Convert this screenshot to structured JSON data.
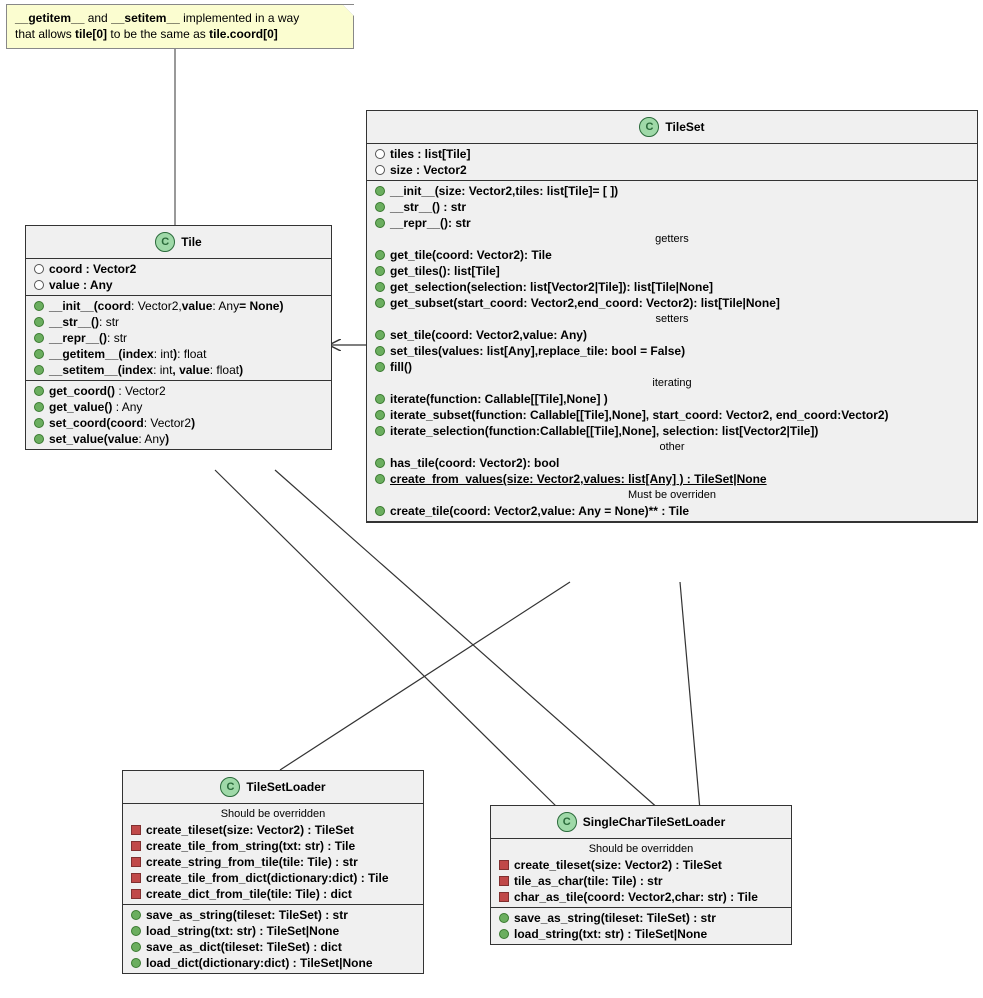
{
  "note": {
    "line1_a": "__getitem__",
    "line1_b": " and ",
    "line1_c": "__setitem__",
    "line1_d": " implemented in a way",
    "line2_a": "that allows ",
    "line2_b": "tile[0]",
    "line2_c": " to be the same as ",
    "line2_d": "tile.coord[0]"
  },
  "tile": {
    "name": "Tile",
    "attrs": {
      "coord": "coord : Vector2",
      "value": "value : Any"
    },
    "methods1": {
      "init_a": "__init__(coord",
      "init_b": ": Vector2,",
      "init_c": "value",
      "init_d": ": Any",
      "init_e": "= None)",
      "str_a": "__str__()",
      "str_b": ": str",
      "repr_a": "__repr__()",
      "repr_b": ": str",
      "getitem_a": "__getitem__(index",
      "getitem_b": ": int",
      "getitem_c": ")",
      "getitem_d": ": float",
      "setitem_a": "__setitem__(index",
      "setitem_b": ": int",
      "setitem_c": ", value",
      "setitem_d": ": float",
      "setitem_e": ")"
    },
    "methods2": {
      "get_coord_a": "get_coord()",
      "get_coord_b": " : Vector2",
      "get_value_a": "get_value()",
      "get_value_b": " : Any",
      "set_coord_a": "set_coord(coord",
      "set_coord_b": ": Vector2",
      "set_coord_c": ")",
      "set_value_a": "set_value(value",
      "set_value_b": ": Any",
      "set_value_c": ")"
    }
  },
  "tileset": {
    "name": "TileSet",
    "attrs": {
      "tiles": "tiles : list[Tile]",
      "size": "size  : Vector2"
    },
    "methods_top": {
      "init": "__init__(size: Vector2,tiles: list[Tile]= [ ])",
      "str": "__str__() : str",
      "repr": "__repr__(): str"
    },
    "label_getters": "getters",
    "getters": {
      "get_tile": "get_tile(coord: Vector2): Tile",
      "get_tiles": "get_tiles(): list[Tile]",
      "get_selection": "get_selection(selection: list[Vector2|Tile]): list[Tile|None]",
      "get_subset": "get_subset(start_coord: Vector2,end_coord: Vector2): list[Tile|None]"
    },
    "label_setters": "setters",
    "setters": {
      "set_tile": "set_tile(coord: Vector2,value: Any)",
      "set_tiles": "set_tiles(values: list[Any],replace_tile: bool = False)",
      "fill": "fill()"
    },
    "label_iterating": "iterating",
    "iterating": {
      "iterate": "iterate(function: Callable[[Tile],None] )",
      "iterate_subset": "iterate_subset(function: Callable[[Tile],None], start_coord: Vector2, end_coord:Vector2)",
      "iterate_selection": "iterate_selection(function:Callable[[Tile],None], selection: list[Vector2|Tile])"
    },
    "label_other": "other",
    "other": {
      "has_tile": "has_tile(coord: Vector2): bool",
      "create_from_values": "create_from_values(size: Vector2,values: list[Any] ) : TileSet|None"
    },
    "label_override": "Must be overriden",
    "override": {
      "create_tile": "create_tile(coord: Vector2,value: Any = None)** : Tile"
    }
  },
  "loader": {
    "name": "TileSetLoader",
    "label_override": "Should be overridden",
    "override": {
      "create_tileset": "create_tileset(size: Vector2) : TileSet",
      "create_tile_from_string": "create_tile_from_string(txt: str) : Tile",
      "create_string_from_tile": "create_string_from_tile(tile: Tile) : str",
      "create_tile_from_dict": "create_tile_from_dict(dictionary:dict) : Tile",
      "create_dict_from_tile": "create_dict_from_tile(tile: Tile) : dict"
    },
    "methods": {
      "save_as_string": "save_as_string(tileset: TileSet) : str",
      "load_string": "load_string(txt: str) : TileSet|None",
      "save_as_dict": "save_as_dict(tileset: TileSet) : dict",
      "load_dict": "load_dict(dictionary:dict) : TileSet|None"
    }
  },
  "single": {
    "name": "SingleCharTileSetLoader",
    "label_override": "Should be overridden",
    "override": {
      "create_tileset": "create_tileset(size: Vector2) : TileSet",
      "tile_as_char": "tile_as_char(tile: Tile) : str",
      "char_as_tile": "char_as_tile(coord: Vector2,char: str) : Tile"
    },
    "methods": {
      "save_as_string": "save_as_string(tileset: TileSet) : str",
      "load_string": "load_string(txt: str) : TileSet|None"
    }
  }
}
